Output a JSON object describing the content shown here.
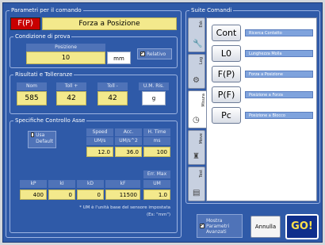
{
  "left_panel": {
    "title": "Parametri per il comando",
    "command_code": "F(P)",
    "command_name": "Forza a Posizione",
    "test_conditions": {
      "title": "Condizione di prova",
      "position_label": "Posizione",
      "position_value": "10",
      "position_unit": "mm",
      "relative_label": "Relativo",
      "relative_checked": true
    },
    "results": {
      "title": "Risultati e Tolleranze",
      "headers": [
        "Nom",
        "Toll +",
        "Toll -",
        "U.M. Ris."
      ],
      "values": [
        "585",
        "42",
        "42"
      ],
      "unit": "g"
    },
    "axis_control": {
      "title": "Specifiche Controllo Asse",
      "use_default_label": "Usa Default",
      "use_default_checked": false,
      "speed_headers": [
        "Speed",
        "Acc.",
        "H. Time"
      ],
      "speed_units": [
        "UM/s",
        "UM/s^2",
        "ms"
      ],
      "speed_values": [
        "12.0",
        "36.0",
        "100"
      ],
      "err_max_header": "Err. Max",
      "pid_headers": [
        "kP",
        "kI",
        "kD",
        "kF",
        "UM"
      ],
      "pid_values": [
        "400",
        "0",
        "0",
        "11500",
        "1.0"
      ],
      "note": "* UM è l'unità base del sensore impostata",
      "note_example": "(Es: \"mm\")"
    }
  },
  "right_panel": {
    "title": "Suite Comandi",
    "tabs": [
      {
        "label": "Esk",
        "icon": "🔧",
        "active": false
      },
      {
        "label": "Log",
        "icon": "⚙",
        "active": false
      },
      {
        "label": "Misura",
        "icon": "◷",
        "active": true
      },
      {
        "label": "Move",
        "icon": "♜",
        "active": false
      },
      {
        "label": "Test",
        "icon": "▤",
        "active": false
      }
    ],
    "commands": [
      {
        "code": "Cont",
        "desc": "Ricerca Contatto"
      },
      {
        "code": "L0",
        "desc": "Lunghezza Molla"
      },
      {
        "code": "F(P)",
        "desc": "Forza a Posizione"
      },
      {
        "code": "P(F)",
        "desc": "Posizione a Forza"
      },
      {
        "code": "Pc",
        "desc": "Posizione a Blocco"
      }
    ]
  },
  "footer": {
    "show_advanced_label": "Mostra Parametri Avanzati",
    "show_advanced_checked": true,
    "cancel_label": "Annulla",
    "go_label": "GO!"
  },
  "colors": {
    "background": "#2f5aa8",
    "field_yellow": "#f3e98c",
    "command_code_red": "#c80000",
    "go_button": "#0f2f8c"
  }
}
